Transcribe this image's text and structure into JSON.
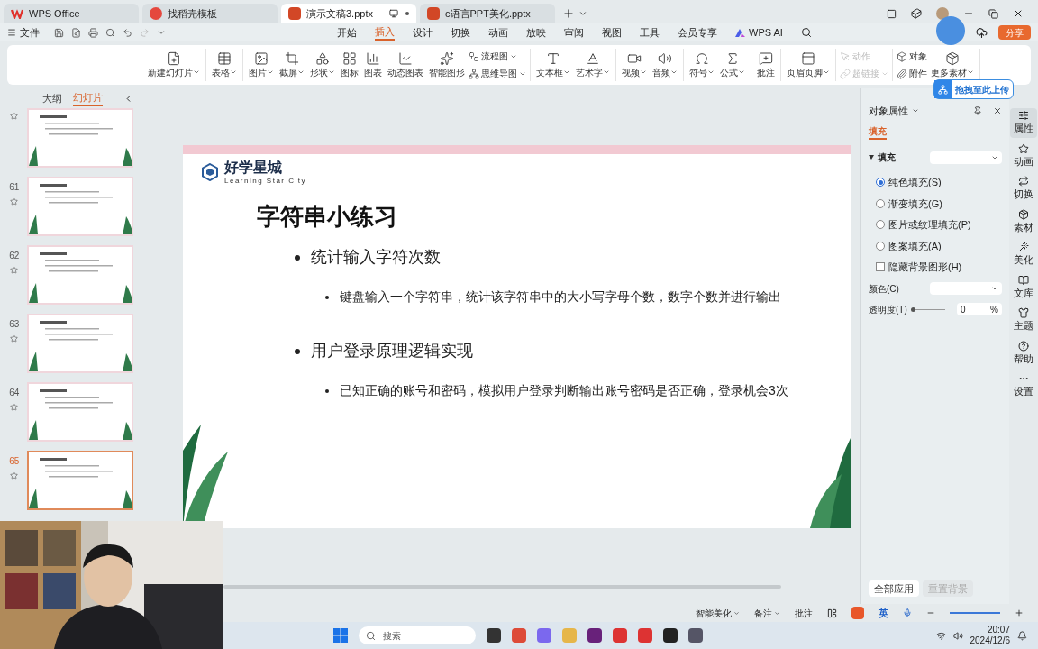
{
  "tabs": [
    {
      "label": "WPS Office",
      "kind": "wps",
      "selected": false
    },
    {
      "label": "找稻壳模板",
      "kind": "template",
      "selected": false
    },
    {
      "label": "演示文稿3.pptx",
      "kind": "ppt",
      "selected": true
    },
    {
      "label": "c语言PPT美化.pptx",
      "kind": "ppt",
      "selected": false
    }
  ],
  "file_menu": "文件",
  "menu_tabs": [
    {
      "label": "开始",
      "selected": false
    },
    {
      "label": "插入",
      "selected": true
    },
    {
      "label": "设计",
      "selected": false
    },
    {
      "label": "切换",
      "selected": false
    },
    {
      "label": "动画",
      "selected": false
    },
    {
      "label": "放映",
      "selected": false
    },
    {
      "label": "审阅",
      "selected": false
    },
    {
      "label": "视图",
      "selected": false
    },
    {
      "label": "工具",
      "selected": false
    },
    {
      "label": "会员专享",
      "selected": false
    }
  ],
  "ai_label": "WPS AI",
  "share_label": "分享",
  "ribbon": [
    {
      "items": [
        {
          "label": "新建幻灯片",
          "kind": "large",
          "has_menu": true,
          "disabled": false
        }
      ]
    },
    {
      "items": [
        {
          "label": "表格",
          "kind": "large",
          "has_menu": true,
          "disabled": false
        }
      ]
    },
    {
      "items": [
        {
          "label": "图片",
          "kind": "large",
          "has_menu": true,
          "disabled": false
        },
        {
          "label": "截屏",
          "kind": "large",
          "has_menu": true,
          "disabled": false
        },
        {
          "label": "形状",
          "kind": "large",
          "has_menu": true,
          "disabled": false
        },
        {
          "label": "图标",
          "kind": "large",
          "has_menu": false,
          "disabled": false
        },
        {
          "label": "图表",
          "kind": "large",
          "has_menu": false,
          "disabled": false
        },
        {
          "label": "动态图表",
          "kind": "large",
          "has_menu": false,
          "disabled": false
        },
        {
          "label": "智能图形",
          "kind": "large",
          "has_menu": false,
          "disabled": false
        },
        {
          "label": "流程图",
          "kind": "small",
          "has_menu": true,
          "disabled": false
        },
        {
          "label": "思维导图",
          "kind": "small",
          "has_menu": true,
          "disabled": false
        }
      ]
    },
    {
      "items": [
        {
          "label": "文本框",
          "kind": "large",
          "has_menu": true,
          "disabled": false
        },
        {
          "label": "艺术字",
          "kind": "large",
          "has_menu": true,
          "disabled": false
        }
      ]
    },
    {
      "items": [
        {
          "label": "视频",
          "kind": "large",
          "has_menu": true,
          "disabled": false
        },
        {
          "label": "音频",
          "kind": "large",
          "has_menu": true,
          "disabled": false
        }
      ]
    },
    {
      "items": [
        {
          "label": "符号",
          "kind": "large",
          "has_menu": true,
          "disabled": false
        },
        {
          "label": "公式",
          "kind": "large",
          "has_menu": true,
          "disabled": false
        }
      ]
    },
    {
      "items": [
        {
          "label": "批注",
          "kind": "large",
          "has_menu": false,
          "disabled": false
        }
      ]
    },
    {
      "items": [
        {
          "label": "页眉页脚",
          "kind": "large",
          "has_menu": true,
          "disabled": false
        }
      ]
    },
    {
      "items": [
        {
          "label": "动作",
          "kind": "small",
          "has_menu": false,
          "disabled": true
        },
        {
          "label": "超链接",
          "kind": "small",
          "has_menu": true,
          "disabled": true
        }
      ]
    },
    {
      "items": [
        {
          "label": "对象",
          "kind": "small",
          "has_menu": false,
          "disabled": false
        },
        {
          "label": "附件",
          "kind": "small",
          "has_menu": false,
          "disabled": false
        },
        {
          "label": "更多素材",
          "kind": "large",
          "has_menu": true,
          "disabled": false
        }
      ]
    }
  ],
  "upload_label": "拖拽至此上传",
  "sidebar": {
    "tabs": [
      {
        "label": "大纲",
        "selected": false
      },
      {
        "label": "幻灯片",
        "selected": true
      }
    ],
    "slides": [
      {
        "selected": false
      },
      {
        "number": "61",
        "selected": false
      },
      {
        "number": "62",
        "selected": false
      },
      {
        "number": "63",
        "selected": false
      },
      {
        "number": "64",
        "selected": false
      },
      {
        "number": "65",
        "selected": true
      }
    ]
  },
  "slide": {
    "logo_title": "好学星城",
    "logo_subtitle": "Learning Star City",
    "title": "字符串小练习",
    "bullets": [
      {
        "text": "统计输入字符次数",
        "children": [
          {
            "text": "键盘输入一个字符串，统计该字符串中的大小写字母个数，数字个数并进行输出"
          }
        ]
      },
      {
        "text": "用户登录原理逻辑实现",
        "children": [
          {
            "text": "已知正确的账号和密码，模拟用户登录判断输出账号密码是否正确，登录机会3次"
          }
        ]
      }
    ]
  },
  "panel": {
    "title": "对象属性",
    "tab": "填充",
    "section": "填充",
    "options": [
      {
        "label": "纯色填充(S)",
        "kind": "radio",
        "checked": true
      },
      {
        "label": "渐变填充(G)",
        "kind": "radio",
        "checked": false
      },
      {
        "label": "图片或纹理填充(P)",
        "kind": "radio",
        "checked": false
      },
      {
        "label": "图案填充(A)",
        "kind": "radio",
        "checked": false
      },
      {
        "label": "隐藏背景图形(H)",
        "kind": "checkbox",
        "checked": false
      }
    ],
    "color_label": "颜色(C)",
    "transparency_label": "透明度(T)",
    "transparency_value": "0",
    "transparency_unit": "%",
    "level": 0,
    "buttons": [
      {
        "label": "全部应用",
        "disabled": false
      },
      {
        "label": "重置背景",
        "disabled": true
      }
    ]
  },
  "rail": [
    {
      "label": "属性",
      "selected": true
    },
    {
      "label": "动画",
      "selected": false
    },
    {
      "label": "切换",
      "selected": false
    },
    {
      "label": "素材",
      "selected": false
    },
    {
      "label": "美化",
      "selected": false
    },
    {
      "label": "文库",
      "selected": false
    },
    {
      "label": "主题",
      "selected": false
    },
    {
      "label": "帮助",
      "selected": false
    },
    {
      "label": "设置",
      "selected": false
    }
  ],
  "status": [
    {
      "label": "智能美化",
      "has_menu": true
    },
    {
      "label": "备注",
      "has_menu": true
    },
    {
      "label": "批注",
      "has_menu": false
    }
  ],
  "ime": "英",
  "taskbar": {
    "search": "搜索",
    "time": "20:07",
    "date": "2024/12/6"
  }
}
